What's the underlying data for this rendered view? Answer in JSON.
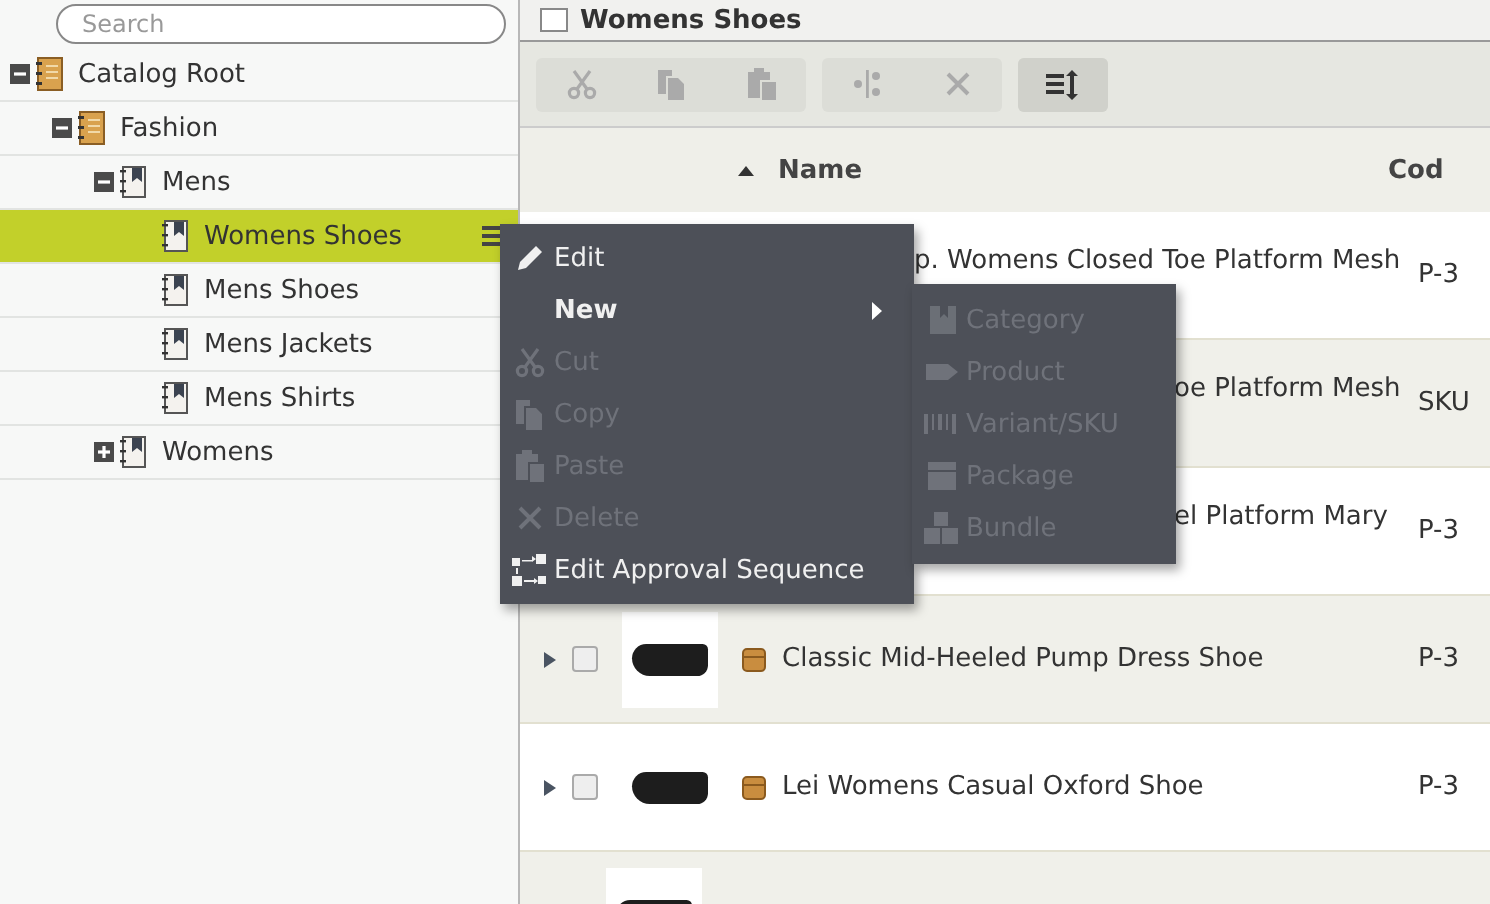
{
  "search": {
    "placeholder": "Search"
  },
  "tree": [
    {
      "label": "Catalog Root",
      "kind": "catalog",
      "expanded": true,
      "selected": false,
      "children": [
        {
          "label": "Fashion",
          "kind": "catalog",
          "expanded": true,
          "selected": false,
          "children": [
            {
              "label": "Mens",
              "kind": "category",
              "expanded": true,
              "selected": false,
              "children": [
                {
                  "label": "Womens Shoes",
                  "kind": "category",
                  "selected": true
                },
                {
                  "label": "Mens Shoes",
                  "kind": "category",
                  "selected": false
                },
                {
                  "label": "Mens Jackets",
                  "kind": "category",
                  "selected": false
                },
                {
                  "label": "Mens Shirts",
                  "kind": "category",
                  "selected": false
                }
              ]
            },
            {
              "label": "Womens",
              "kind": "category",
              "expanded": false,
              "selected": false
            }
          ]
        }
      ]
    }
  ],
  "panel": {
    "title": "Womens Shoes",
    "checked": false
  },
  "toolbar": [
    {
      "kind": "cut",
      "disabled": true
    },
    {
      "kind": "copy",
      "disabled": true
    },
    {
      "kind": "paste",
      "disabled": true
    },
    {
      "kind": "split",
      "disabled": true
    },
    {
      "kind": "delete",
      "disabled": true
    },
    {
      "kind": "sort",
      "disabled": false
    }
  ],
  "table": {
    "columns": [
      {
        "label": "Name",
        "sorted": true
      },
      {
        "label": "Cod"
      }
    ],
    "rows": [
      {
        "name": "p. Womens Closed Toe Platform Mesh",
        "code": "P-3"
      },
      {
        "name": "oe Platform Mesh",
        "code": "SKU"
      },
      {
        "name": "el Platform Mary",
        "code": "P-3"
      },
      {
        "name": "Classic Mid-Heeled Pump Dress Shoe",
        "code": "P-3",
        "checked": false
      },
      {
        "name": "Lei Womens Casual Oxford Shoe",
        "code": "P-3",
        "checked": false
      },
      {}
    ]
  },
  "context_menu": {
    "items": [
      {
        "label": "Edit",
        "kind": "edit",
        "disabled": false,
        "submenu": false
      },
      {
        "label": "New",
        "kind": "new",
        "disabled": false,
        "submenu": true
      },
      {
        "label": "Cut",
        "kind": "cut",
        "disabled": true,
        "submenu": false
      },
      {
        "label": "Copy",
        "kind": "copy",
        "disabled": true,
        "submenu": false
      },
      {
        "label": "Paste",
        "kind": "paste",
        "disabled": true,
        "submenu": false
      },
      {
        "label": "Delete",
        "kind": "delete",
        "disabled": true,
        "submenu": false
      },
      {
        "label": "Edit Approval Sequence",
        "kind": "approval",
        "disabled": false,
        "submenu": false
      }
    ],
    "submenu": [
      {
        "label": "Category",
        "kind": "category",
        "disabled": true
      },
      {
        "label": "Product",
        "kind": "product",
        "disabled": true
      },
      {
        "label": "Variant/SKU",
        "kind": "variant",
        "disabled": true
      },
      {
        "label": "Package",
        "kind": "package",
        "disabled": true
      },
      {
        "label": "Bundle",
        "kind": "bundle",
        "disabled": true
      }
    ]
  }
}
